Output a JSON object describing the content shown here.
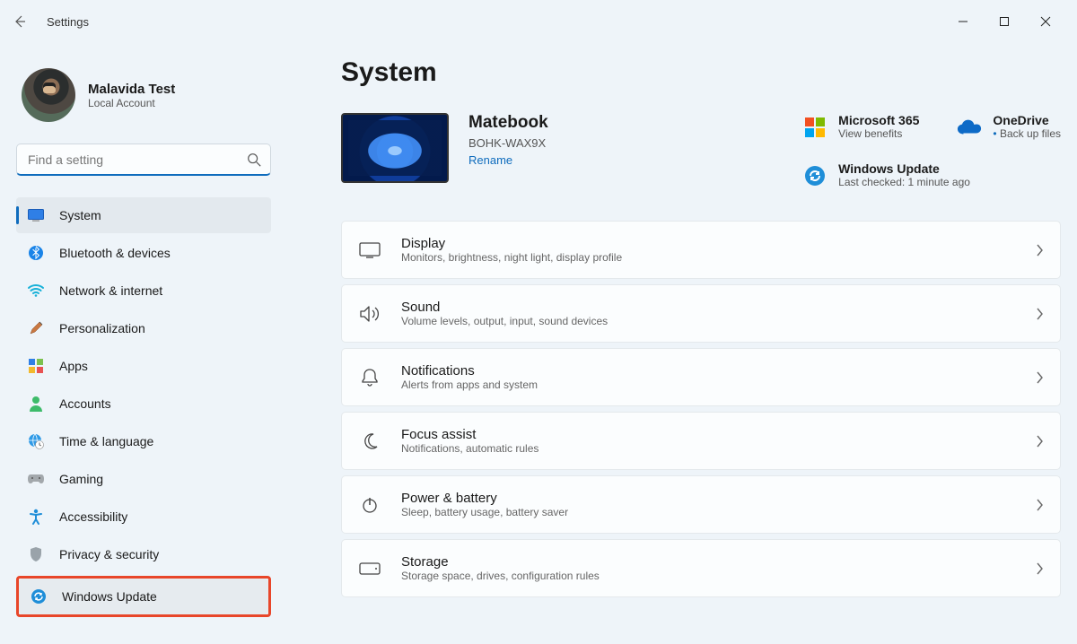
{
  "window": {
    "title": "Settings"
  },
  "profile": {
    "name": "Malavida Test",
    "subtitle": "Local Account"
  },
  "search": {
    "placeholder": "Find a setting"
  },
  "sidebar": {
    "items": [
      {
        "label": "System",
        "icon": "monitor-icon",
        "selected": true
      },
      {
        "label": "Bluetooth & devices",
        "icon": "bluetooth-icon"
      },
      {
        "label": "Network & internet",
        "icon": "wifi-icon"
      },
      {
        "label": "Personalization",
        "icon": "brush-icon"
      },
      {
        "label": "Apps",
        "icon": "apps-icon"
      },
      {
        "label": "Accounts",
        "icon": "person-icon"
      },
      {
        "label": "Time & language",
        "icon": "globe-clock-icon"
      },
      {
        "label": "Gaming",
        "icon": "gamepad-icon"
      },
      {
        "label": "Accessibility",
        "icon": "accessibility-icon"
      },
      {
        "label": "Privacy & security",
        "icon": "shield-icon"
      },
      {
        "label": "Windows Update",
        "icon": "update-icon",
        "highlighted": true
      }
    ]
  },
  "page": {
    "title": "System"
  },
  "device": {
    "name": "Matebook",
    "model": "BOHK-WAX9X",
    "rename": "Rename"
  },
  "tiles": {
    "m365": {
      "title": "Microsoft 365",
      "subtitle": "View benefits"
    },
    "onedrive": {
      "title": "OneDrive",
      "subtitle": "Back up files"
    },
    "update": {
      "title": "Windows Update",
      "subtitle": "Last checked: 1 minute ago"
    }
  },
  "cards": [
    {
      "title": "Display",
      "subtitle": "Monitors, brightness, night light, display profile",
      "icon": "display-icon"
    },
    {
      "title": "Sound",
      "subtitle": "Volume levels, output, input, sound devices",
      "icon": "sound-icon"
    },
    {
      "title": "Notifications",
      "subtitle": "Alerts from apps and system",
      "icon": "bell-icon"
    },
    {
      "title": "Focus assist",
      "subtitle": "Notifications, automatic rules",
      "icon": "moon-icon"
    },
    {
      "title": "Power & battery",
      "subtitle": "Sleep, battery usage, battery saver",
      "icon": "power-icon"
    },
    {
      "title": "Storage",
      "subtitle": "Storage space, drives, configuration rules",
      "icon": "drive-icon"
    }
  ]
}
